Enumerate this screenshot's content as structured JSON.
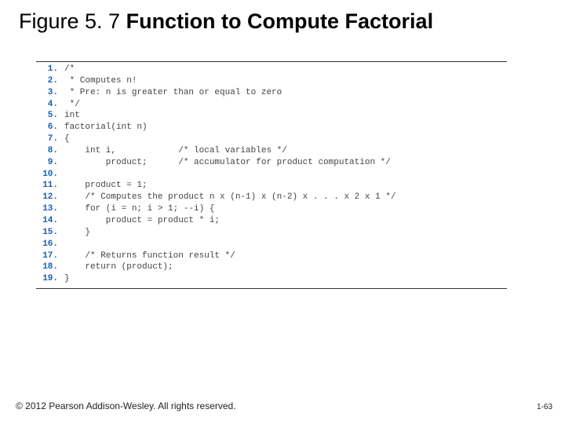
{
  "title_prefix": "Figure 5. 7  ",
  "title_bold": "Function to Compute Factorial",
  "code": {
    "lines": [
      {
        "n": "1.",
        "t": "/*"
      },
      {
        "n": "2.",
        "t": " * Computes n!"
      },
      {
        "n": "3.",
        "t": " * Pre: n is greater than or equal to zero"
      },
      {
        "n": "4.",
        "t": " */"
      },
      {
        "n": "5.",
        "t": "int"
      },
      {
        "n": "6.",
        "t": "factorial(int n)"
      },
      {
        "n": "7.",
        "t": "{"
      },
      {
        "n": "8.",
        "t": "    int i,            /* local variables */"
      },
      {
        "n": "9.",
        "t": "        product;      /* accumulator for product computation */"
      },
      {
        "n": "10.",
        "t": ""
      },
      {
        "n": "11.",
        "t": "    product = 1;"
      },
      {
        "n": "12.",
        "t": "    /* Computes the product n x (n-1) x (n-2) x . . . x 2 x 1 */"
      },
      {
        "n": "13.",
        "t": "    for (i = n; i > 1; --i) {"
      },
      {
        "n": "14.",
        "t": "        product = product * i;"
      },
      {
        "n": "15.",
        "t": "    }"
      },
      {
        "n": "16.",
        "t": ""
      },
      {
        "n": "17.",
        "t": "    /* Returns function result */"
      },
      {
        "n": "18.",
        "t": "    return (product);"
      },
      {
        "n": "19.",
        "t": "}"
      }
    ]
  },
  "footer": "© 2012 Pearson Addison-Wesley. All rights reserved.",
  "page_number": "1-63"
}
